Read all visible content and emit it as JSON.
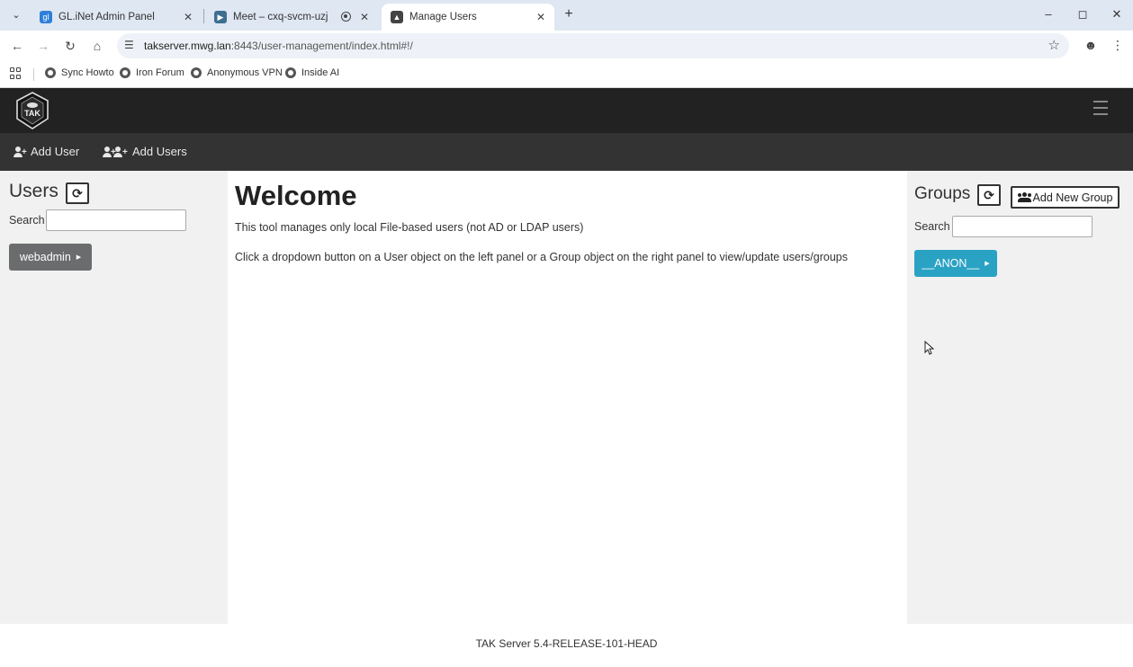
{
  "browser": {
    "tabs": [
      {
        "title": "GL.iNet Admin Panel",
        "favicon": "glinet-icon"
      },
      {
        "title": "Meet – cxq-svcm-uzj",
        "favicon": "meet-icon"
      },
      {
        "title": "Manage Users",
        "favicon": "tak-icon",
        "active": true
      }
    ],
    "url_host": "takserver.mwg.lan",
    "url_path": ":8443/user-management/index.html#!/",
    "bookmarks": [
      {
        "label": "Sync Howto"
      },
      {
        "label": "Iron Forum"
      },
      {
        "label": "Anonymous VPN"
      },
      {
        "label": "Inside AI"
      }
    ]
  },
  "app": {
    "logo_text": "TAK",
    "actions": {
      "add_user": "Add User",
      "add_users": "Add Users"
    }
  },
  "users_panel": {
    "title": "Users",
    "search_label": "Search",
    "search_value": "",
    "items": [
      {
        "label": "webadmin"
      }
    ]
  },
  "main": {
    "heading": "Welcome",
    "line1": "This tool manages only local File-based users (not AD or LDAP users)",
    "line2": "Click a dropdown button on a User object on the left panel or a Group object on the right panel to view/update users/groups"
  },
  "groups_panel": {
    "title": "Groups",
    "add_button": "Add New Group",
    "search_label": "Search",
    "search_value": "",
    "items": [
      {
        "label": "__ANON__"
      }
    ]
  },
  "footer": {
    "version": "TAK Server 5.4-RELEASE-101-HEAD"
  },
  "colors": {
    "topbar": "#222222",
    "actionbar": "#333333",
    "panel_bg": "#f0f1f0",
    "user_pill": "#6b6c6e",
    "group_pill": "#2aa2c4"
  }
}
